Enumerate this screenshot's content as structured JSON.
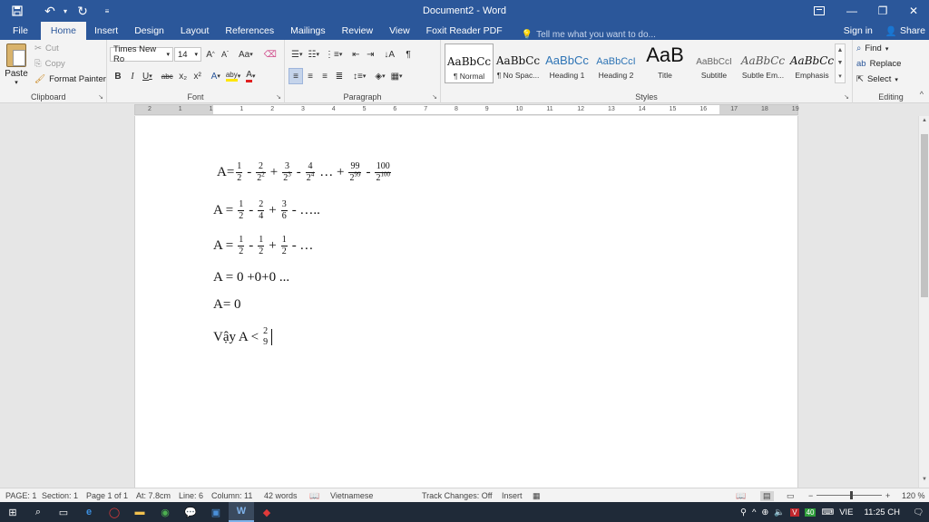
{
  "window": {
    "title": "Document2 - Word",
    "quick_access": [
      "save-icon",
      "undo-icon",
      "redo-icon",
      "customize-icon"
    ]
  },
  "tabs": {
    "items": [
      "File",
      "Home",
      "Insert",
      "Design",
      "Layout",
      "References",
      "Mailings",
      "Review",
      "View",
      "Foxit Reader PDF"
    ],
    "active": "Home",
    "tell_me": "Tell me what you want to do...",
    "sign_in": "Sign in",
    "share": "Share"
  },
  "ribbon": {
    "clipboard": {
      "label": "Clipboard",
      "paste": "Paste",
      "cut": "Cut",
      "copy": "Copy",
      "format_painter": "Format Painter"
    },
    "font": {
      "label": "Font",
      "font_name": "Times New Ro",
      "font_size": "14",
      "grow": "A",
      "shrink": "A",
      "change_case": "Aa",
      "bold": "B",
      "italic": "I",
      "underline": "U",
      "strikethrough": "abc",
      "subscript": "x₂",
      "superscript": "x²",
      "text_effects": "A",
      "highlight": "aby",
      "font_color": "A"
    },
    "paragraph": {
      "label": "Paragraph",
      "pilcrow": "¶"
    },
    "styles": {
      "label": "Styles",
      "items": [
        {
          "sample": "AaBbCc",
          "name": "¶ Normal"
        },
        {
          "sample": "AaBbCc",
          "name": "¶ No Spac..."
        },
        {
          "sample": "AaBbCc",
          "name": "Heading 1"
        },
        {
          "sample": "AaBbCcI",
          "name": "Heading 2"
        },
        {
          "sample": "AaB",
          "name": "Title"
        },
        {
          "sample": "AaBbCcI",
          "name": "Subtitle"
        },
        {
          "sample": "AaBbCc",
          "name": "Subtle Em..."
        },
        {
          "sample": "AaBbCc",
          "name": "Emphasis"
        }
      ]
    },
    "editing": {
      "label": "Editing",
      "find": "Find",
      "replace": "Replace",
      "select": "Select"
    }
  },
  "ruler": {
    "numbers": [
      "2",
      "1",
      "1",
      "1",
      "2",
      "3",
      "4",
      "5",
      "6",
      "7",
      "8",
      "9",
      "10",
      "11",
      "12",
      "13",
      "14",
      "15",
      "16",
      "17",
      "18",
      "19"
    ]
  },
  "document": {
    "line1": {
      "prefix": "A=",
      "terms": [
        {
          "num": "1",
          "den": "2",
          "exp": ""
        },
        {
          "op": "-",
          "num": "2",
          "den": "2",
          "exp": "2"
        },
        {
          "op": "+",
          "num": "3",
          "den": "2",
          "exp": "3"
        },
        {
          "op": "-",
          "num": "4",
          "den": "2",
          "exp": "4"
        },
        {
          "op": "… +",
          "num": "99",
          "den": "2",
          "exp": "99"
        },
        {
          "op": "-",
          "num": "100",
          "den": "2",
          "exp": "100"
        }
      ]
    },
    "line2": {
      "prefix": "A =",
      "n1": "1",
      "d1": "2",
      "op1": "-",
      "n2": "2",
      "d2": "4",
      "op2": "+",
      "n3": "3",
      "d3": "6",
      "tail": "- ….."
    },
    "line3": {
      "prefix": "A =",
      "n1": "1",
      "d1": "2",
      "op1": "-",
      "n2": "1",
      "d2": "2",
      "op2": "+",
      "n3": "1",
      "d3": "2",
      "tail": "- …"
    },
    "line4": "A = 0 +0+0 ...",
    "line5": "A= 0",
    "line6": {
      "prefix": "Vậy A <",
      "num": "2",
      "den": "9"
    }
  },
  "status": {
    "page": "PAGE: 1",
    "section": "Section: 1",
    "page_of": "Page 1 of 1",
    "at": "At: 7.8cm",
    "line": "Line: 6",
    "column": "Column: 11",
    "words": "42 words",
    "language": "Vietnamese",
    "track_changes": "Track Changes: Off",
    "insert": "Insert",
    "zoom": "120 %"
  },
  "taskbar": {
    "lang": "VIE",
    "time": "11:25 CH",
    "badge": "40"
  }
}
